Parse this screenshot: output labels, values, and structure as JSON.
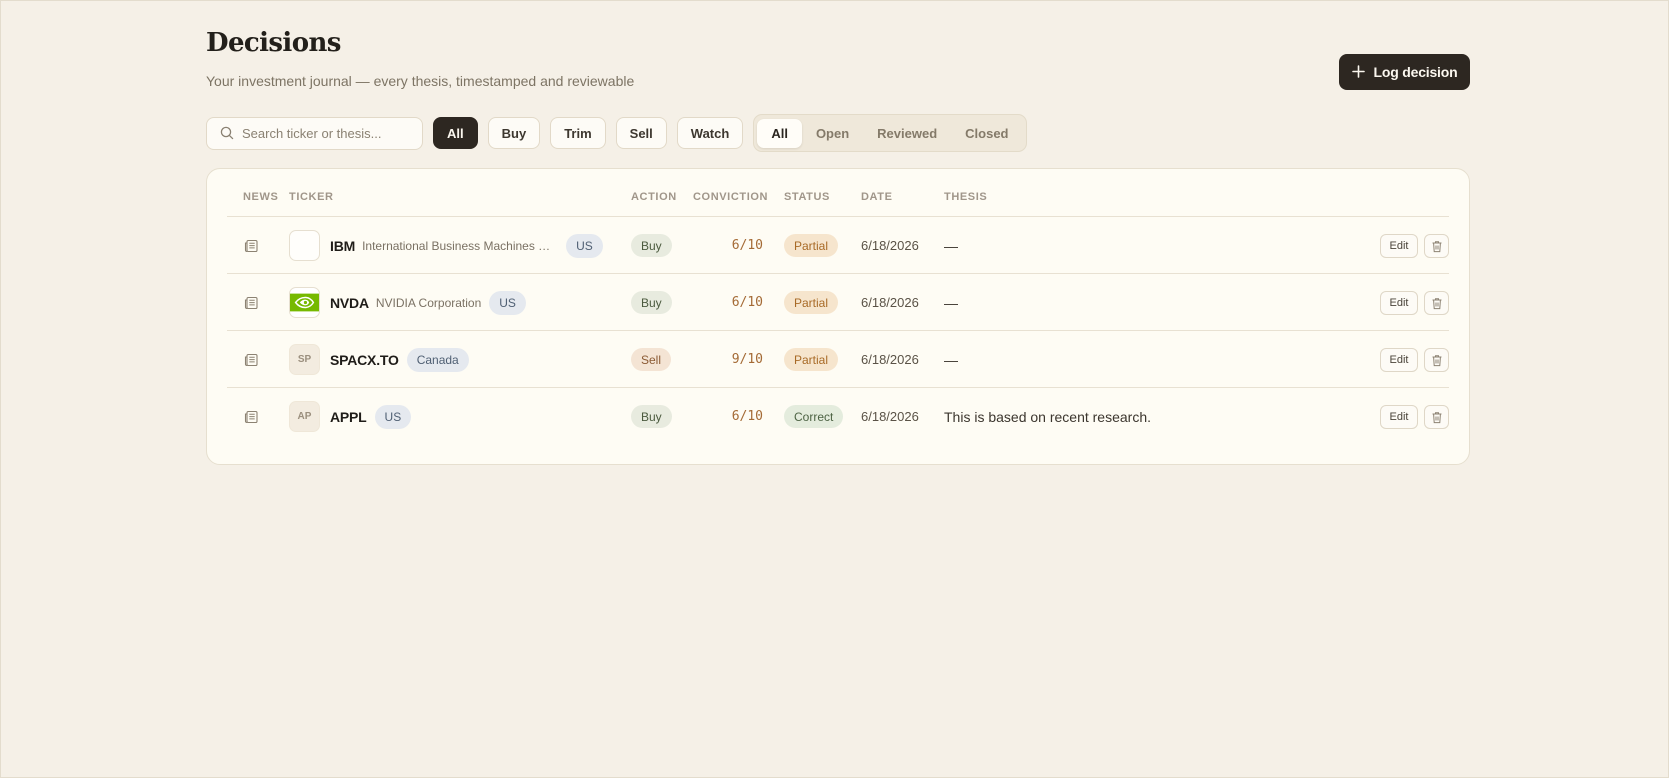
{
  "header": {
    "title": "Decisions",
    "subtitle": "Your investment journal — every thesis, timestamped and reviewable",
    "log_button": "Log decision"
  },
  "search": {
    "placeholder": "Search ticker or thesis...",
    "value": ""
  },
  "action_filters": [
    {
      "label": "All",
      "active": true
    },
    {
      "label": "Buy",
      "active": false
    },
    {
      "label": "Trim",
      "active": false
    },
    {
      "label": "Sell",
      "active": false
    },
    {
      "label": "Watch",
      "active": false
    }
  ],
  "status_filters": [
    {
      "label": "All",
      "active": true
    },
    {
      "label": "Open",
      "active": false
    },
    {
      "label": "Reviewed",
      "active": false
    },
    {
      "label": "Closed",
      "active": false
    }
  ],
  "table": {
    "columns": {
      "news": "NEWS",
      "ticker": "TICKER",
      "action": "ACTION",
      "conviction": "CONVICTION",
      "status": "STATUS",
      "date": "DATE",
      "thesis": "THESIS"
    },
    "rows": [
      {
        "symbol": "IBM",
        "company": "International Business Machines Cor...",
        "market": "US",
        "logo": "blank",
        "action": "Buy",
        "conviction": "6/10",
        "status": "Partial",
        "date": "6/18/2026",
        "thesis": "—"
      },
      {
        "symbol": "NVDA",
        "company": "NVIDIA Corporation",
        "market": "US",
        "logo": "nvidia-logo",
        "action": "Buy",
        "conviction": "6/10",
        "status": "Partial",
        "date": "6/18/2026",
        "thesis": "—"
      },
      {
        "symbol": "SPACX.TO",
        "company": "",
        "market": "Canada",
        "logo": "SP",
        "action": "Sell",
        "conviction": "9/10",
        "status": "Partial",
        "date": "6/18/2026",
        "thesis": "—"
      },
      {
        "symbol": "APPL",
        "company": "",
        "market": "US",
        "logo": "AP",
        "action": "Buy",
        "conviction": "6/10",
        "status": "Correct",
        "date": "6/18/2026",
        "thesis": "This is based on recent research."
      }
    ],
    "edit_label": "Edit"
  },
  "colors": {
    "background": "#f5f0e7",
    "card": "#fefcf4",
    "primary_dark": "#2d2721",
    "partial": "#f6e5cd",
    "correct": "#e4ecdd",
    "conviction_text": "#a46a35"
  }
}
